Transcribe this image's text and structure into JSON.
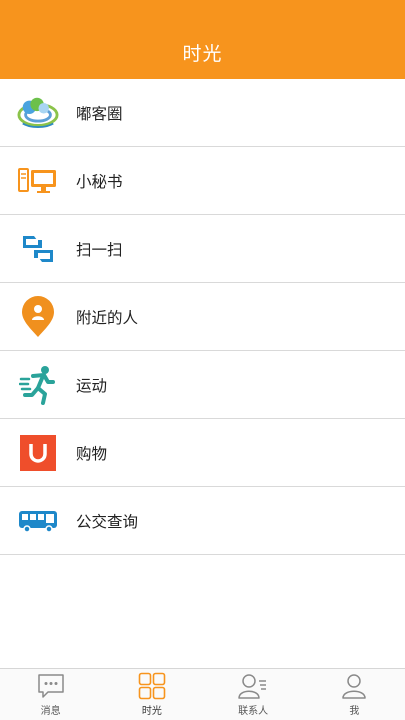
{
  "header": {
    "title": "时光"
  },
  "menu": {
    "items": [
      {
        "label": "嘟客圈",
        "icon": "cloud-circle-icon"
      },
      {
        "label": "小秘书",
        "icon": "desktop-computer-icon"
      },
      {
        "label": "扫一扫",
        "icon": "scan-icon"
      },
      {
        "label": "附近的人",
        "icon": "location-person-icon"
      },
      {
        "label": "运动",
        "icon": "running-person-icon"
      },
      {
        "label": "购物",
        "icon": "shopping-bag-icon"
      },
      {
        "label": "公交查询",
        "icon": "bus-icon"
      }
    ]
  },
  "tabbar": {
    "tabs": [
      {
        "label": "消息",
        "icon": "chat-bubble-icon",
        "active": false
      },
      {
        "label": "时光",
        "icon": "grid-icon",
        "active": true
      },
      {
        "label": "联系人",
        "icon": "contacts-icon",
        "active": false
      },
      {
        "label": "我",
        "icon": "user-icon",
        "active": false
      }
    ]
  },
  "colors": {
    "accent": "#F7941D",
    "divider": "#d9d9d9",
    "tab_active": "#F7941D",
    "tab_inactive": "#8a8a8a"
  }
}
